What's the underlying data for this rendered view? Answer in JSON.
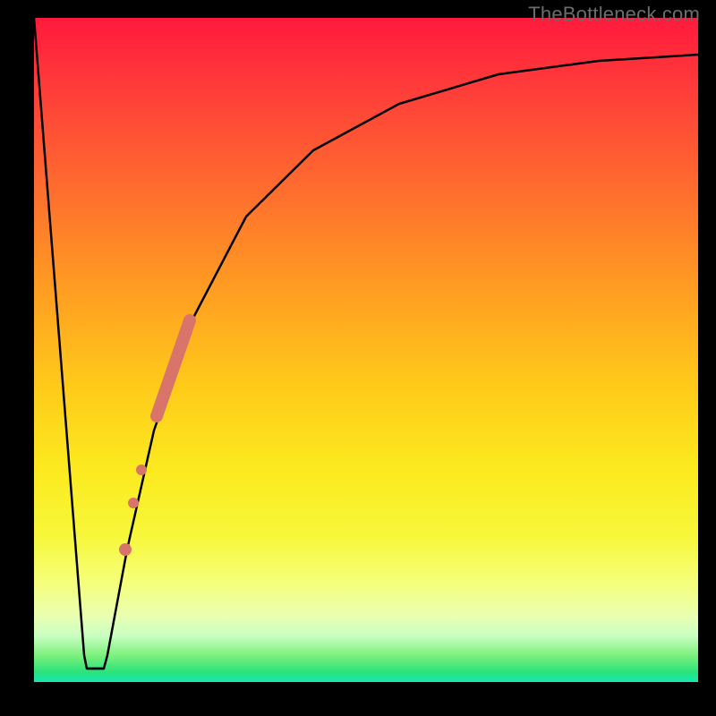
{
  "attribution": "TheBottleneck.com",
  "chart_data": {
    "type": "line",
    "title": "",
    "xlabel": "",
    "ylabel": "",
    "xlim": [
      0,
      100
    ],
    "ylim": [
      0,
      100
    ],
    "grid": false,
    "legend": false,
    "curve": [
      {
        "x": 0.0,
        "y": 100.0
      },
      {
        "x": 7.5,
        "y": 4.0
      },
      {
        "x": 8.0,
        "y": 2.0
      },
      {
        "x": 10.5,
        "y": 2.0
      },
      {
        "x": 11.0,
        "y": 4.0
      },
      {
        "x": 14.0,
        "y": 20.0
      },
      {
        "x": 18.0,
        "y": 38.0
      },
      {
        "x": 24.0,
        "y": 55.0
      },
      {
        "x": 32.0,
        "y": 70.0
      },
      {
        "x": 42.0,
        "y": 80.0
      },
      {
        "x": 55.0,
        "y": 87.0
      },
      {
        "x": 70.0,
        "y": 91.5
      },
      {
        "x": 85.0,
        "y": 93.5
      },
      {
        "x": 100.0,
        "y": 94.5
      }
    ],
    "highlight_segment": {
      "x1": 18.5,
      "y1": 40.0,
      "x2": 23.5,
      "y2": 54.5,
      "color": "#d9746b"
    },
    "highlight_dots": [
      {
        "x": 16.2,
        "y": 32.0,
        "r": 6,
        "color": "#d9746b"
      },
      {
        "x": 15.0,
        "y": 27.0,
        "r": 6,
        "color": "#d9746b"
      },
      {
        "x": 13.7,
        "y": 20.0,
        "r": 7,
        "color": "#d9746b"
      }
    ]
  }
}
